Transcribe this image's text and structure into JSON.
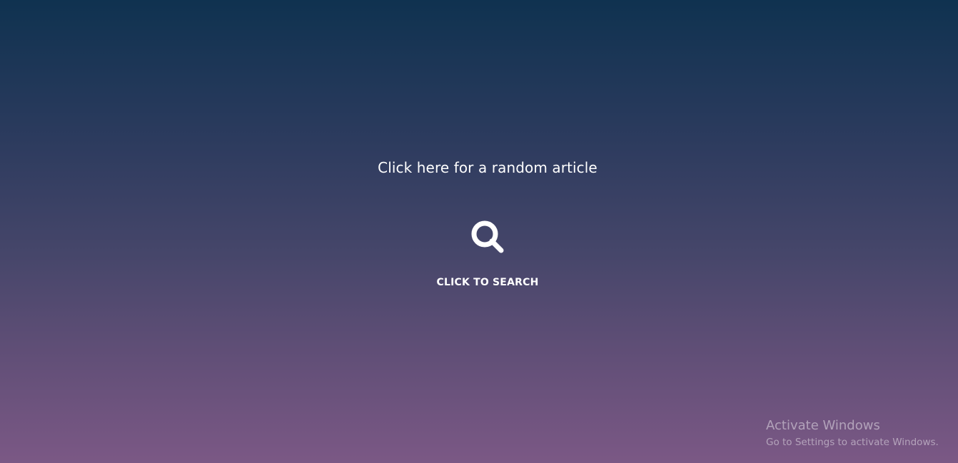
{
  "random_article": {
    "label": "Click here for a random article"
  },
  "search": {
    "icon": "search-icon",
    "label": "CLICK TO SEARCH"
  },
  "watermark": {
    "title": "Activate Windows",
    "subtitle": "Go to Settings to activate Windows."
  },
  "colors": {
    "gradient_top": "#0f3250",
    "gradient_bottom": "#7b5885",
    "text": "#ffffff"
  }
}
